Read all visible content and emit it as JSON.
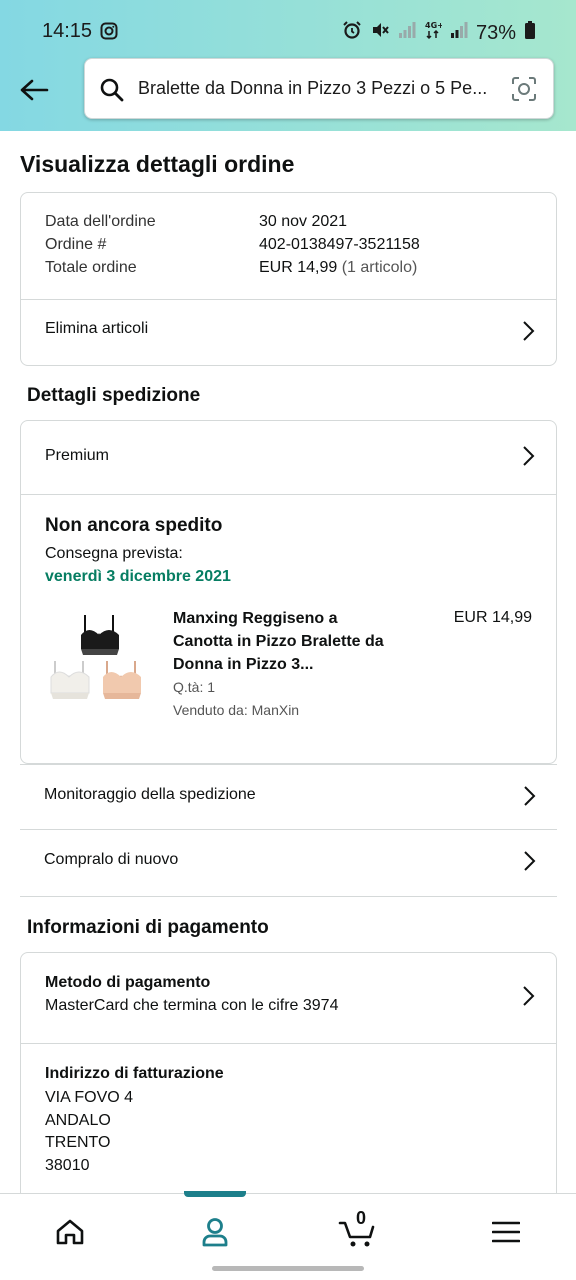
{
  "status_bar": {
    "time": "14:15",
    "battery": "73%",
    "icons": [
      "instagram-icon",
      "alarm-icon",
      "mute-icon",
      "signal-icon",
      "4g-icon",
      "signal-icon",
      "battery-icon"
    ]
  },
  "search": {
    "query": "Bralette da Donna in Pizzo 3 Pezzi o 5 Pe..."
  },
  "page": {
    "title": "Visualizza dettagli ordine"
  },
  "order_summary": {
    "date_label": "Data dell'ordine",
    "date_value": "30 nov 2021",
    "number_label": "Ordine #",
    "number_value": "402-0138497-3521158",
    "total_label": "Totale ordine",
    "total_value": "EUR 14,99",
    "total_items": "(1 articolo)",
    "remove_items_label": "Elimina articoli"
  },
  "shipping": {
    "section_title": "Dettagli spedizione",
    "method": "Premium",
    "status": "Non ancora spedito",
    "delivery_label": "Consegna prevista:",
    "delivery_date": "venerdì 3 dicembre 2021",
    "product": {
      "name_line1": "Manxing Reggiseno a",
      "name_line2": "Canotta in Pizzo Bralette da",
      "name_line3": "Donna in Pizzo 3...",
      "price": "EUR 14,99",
      "qty": "Q.tà: 1",
      "seller": "Venduto da: ManXin"
    },
    "track_label": "Monitoraggio della spedizione",
    "buy_again_label": "Compralo di nuovo"
  },
  "payment": {
    "section_title": "Informazioni di pagamento",
    "method_title": "Metodo di pagamento",
    "method_value": "MasterCard che termina con le cifre 3974",
    "billing_title": "Indirizzo di fatturazione",
    "address_line1": "VIA FOVO 4",
    "address_line2": "ANDALO",
    "address_line3": "TRENTO",
    "address_line4": "38010"
  },
  "bottom_nav": {
    "cart_count": "0",
    "active": "account"
  },
  "colors": {
    "accent": "#1d7f8b",
    "green": "#067d62",
    "header_left": "#84d8e3",
    "header_right": "#a6e7ce"
  }
}
